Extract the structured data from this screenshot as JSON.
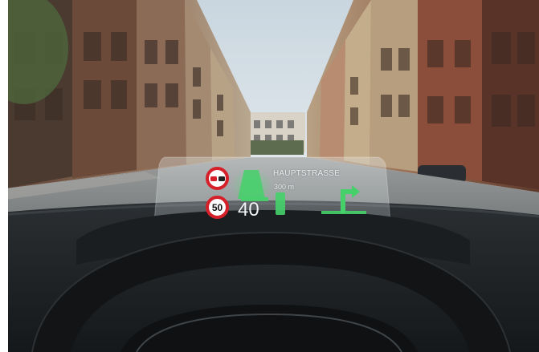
{
  "hud": {
    "street_name": "HAUPTSTRASSE",
    "distance": "300 m",
    "current_speed": "40",
    "speed_limit": "50",
    "overtake_sign_icon": "no-overtaking-sign-icon",
    "turn_icon": "turn-right-arrow-icon",
    "lane_icon": "lane-guidance-icon"
  },
  "colors": {
    "sign_red": "#d5202a",
    "hud_green": "#3fd46a",
    "dashboard": "#1f2326"
  }
}
